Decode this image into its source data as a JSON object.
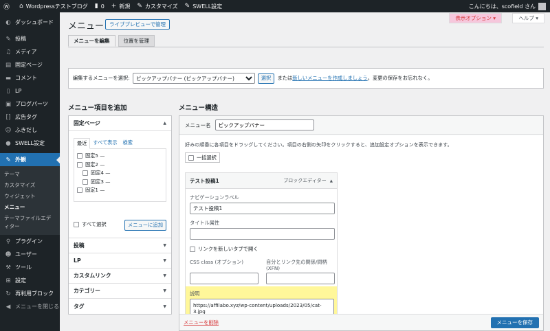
{
  "adminbar": {
    "wp_logo": "wordpress-icon",
    "site_name": "Wordpressテストブログ",
    "comments_count": "0",
    "new_label": "新規",
    "customize_label": "カスタマイズ",
    "swell_label": "SWELL設定",
    "greeting": "こんにちは、scofield さん"
  },
  "sidebar": {
    "items": [
      {
        "label": "ダッシュボード",
        "icon": "dashboard-icon"
      },
      {
        "label": "投稿",
        "icon": "pin-icon"
      },
      {
        "label": "メディア",
        "icon": "media-icon"
      },
      {
        "label": "固定ページ",
        "icon": "page-icon"
      },
      {
        "label": "コメント",
        "icon": "comment-icon"
      },
      {
        "label": "LP",
        "icon": "lp-icon"
      },
      {
        "label": "ブログパーツ",
        "icon": "folder-icon"
      },
      {
        "label": "広告タグ",
        "icon": "ad-icon"
      },
      {
        "label": "ふきだし",
        "icon": "balloon-icon"
      },
      {
        "label": "SWELL設定",
        "icon": "swell-icon"
      },
      {
        "label": "外観",
        "icon": "brush-icon"
      },
      {
        "label": "プラグイン",
        "icon": "plugin-icon"
      },
      {
        "label": "ユーザー",
        "icon": "user-icon"
      },
      {
        "label": "ツール",
        "icon": "wrench-icon"
      },
      {
        "label": "設定",
        "icon": "settings-icon"
      },
      {
        "label": "再利用ブロック",
        "icon": "reuse-icon"
      },
      {
        "label": "メニューを閉じる",
        "icon": "collapse-icon"
      }
    ],
    "submenu": [
      "テーマ",
      "カスタマイズ",
      "ウィジェット",
      "メニュー",
      "テーマファイルエディター"
    ]
  },
  "header": {
    "title": "メニュー",
    "live_preview": "ライブプレビューで管理",
    "screen_options": "表示オプション ▾",
    "help": "ヘルプ ▾",
    "tabs": [
      "メニューを編集",
      "位置を管理"
    ]
  },
  "select_menu": {
    "label": "編集するメニューを選択:",
    "selected": "ピックアップバナー (ピックアップバナー)",
    "select_btn": "選択",
    "or_text": "または",
    "create_link": "新しいメニューを作成しましょう",
    "save_note": "。変更の保存をお忘れなく。"
  },
  "left": {
    "heading": "メニュー項目を追加",
    "pages_header": "固定ページ",
    "page_tabs": [
      "最近",
      "すべて表示",
      "検索"
    ],
    "pages": [
      "固定5 —",
      "固定2 —",
      "固定4 —",
      "固定3 —",
      "固定1 —"
    ],
    "select_all": "すべて選択",
    "add_btn": "メニューに追加",
    "other_sections": [
      "投稿",
      "LP",
      "カスタムリンク",
      "カテゴリー",
      "タグ"
    ]
  },
  "right": {
    "heading": "メニュー構造",
    "menu_name_label": "メニュー名",
    "menu_name_value": "ピックアップバナー",
    "instructions": "好みの順番に各項目をドラッグしてください。項目の右側の矢印をクリックすると、追加設定オプションを表示できます。",
    "bulk_select": "一括選択",
    "item": {
      "title": "テスト投稿1",
      "type": "ブロックエディター",
      "nav_label": "ナビゲーションラベル",
      "nav_value": "テスト投稿1",
      "title_attr": "タイトル属性",
      "title_attr_value": "",
      "new_tab": "リンクを新しいタブで開く",
      "css_label": "CSS class (オプション)",
      "xfn_label": "自分とリンク先の関係/間柄 (XFN)",
      "desc_label": "説明",
      "desc_value": "https://affilabo.xyz/wp-content/uploads/2023/05/cat-3.jpg"
    },
    "delete_link": "メニューを削除",
    "save_btn": "メニューを保存"
  },
  "colors": {
    "adminbar": "#1d2327",
    "accent": "#2271b1",
    "highlight": "#fff79a",
    "danger": "#d63638"
  }
}
